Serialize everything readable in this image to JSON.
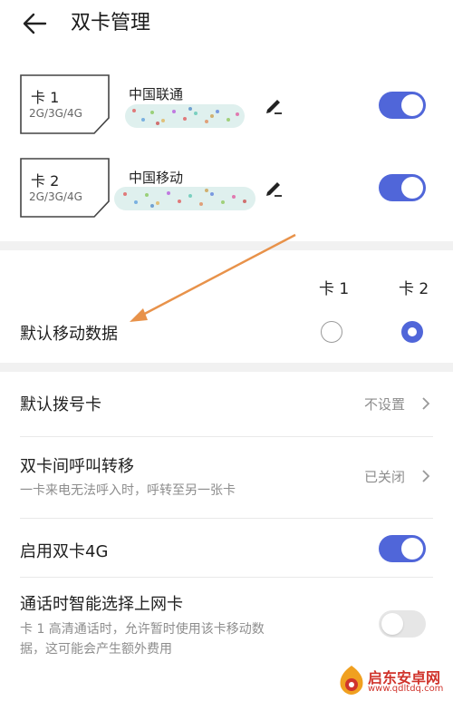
{
  "header": {
    "title": "双卡管理"
  },
  "sims": [
    {
      "title": "卡 1",
      "bands": "2G/3G/4G",
      "carrier": "中国联通",
      "enabled": true
    },
    {
      "title": "卡 2",
      "bands": "2G/3G/4G",
      "carrier": "中国移动",
      "enabled": true
    }
  ],
  "mobile_data": {
    "label": "默认移动数据",
    "col1": "卡 1",
    "col2": "卡 2",
    "selected": "卡 2"
  },
  "settings": [
    {
      "label": "默认拨号卡",
      "value": "不设置"
    },
    {
      "label": "双卡间呼叫转移",
      "sub": "一卡来电无法呼入时，呼转至另一张卡",
      "value": "已关闭"
    },
    {
      "label": "启用双卡4G",
      "toggle": true
    },
    {
      "label": "通话时智能选择上网卡",
      "sub_line1": "卡 1 高清通话时，允许暂时使用该卡移动数",
      "sub_line2": "据，这可能会产生额外费用",
      "toggle": false
    }
  ],
  "colors": {
    "accent": "#5066d9",
    "annotation_arrow": "#e8924a",
    "watermark": "#d0342c"
  },
  "watermark": {
    "name": "启东安卓网",
    "url": "www.qdltdq.com"
  }
}
